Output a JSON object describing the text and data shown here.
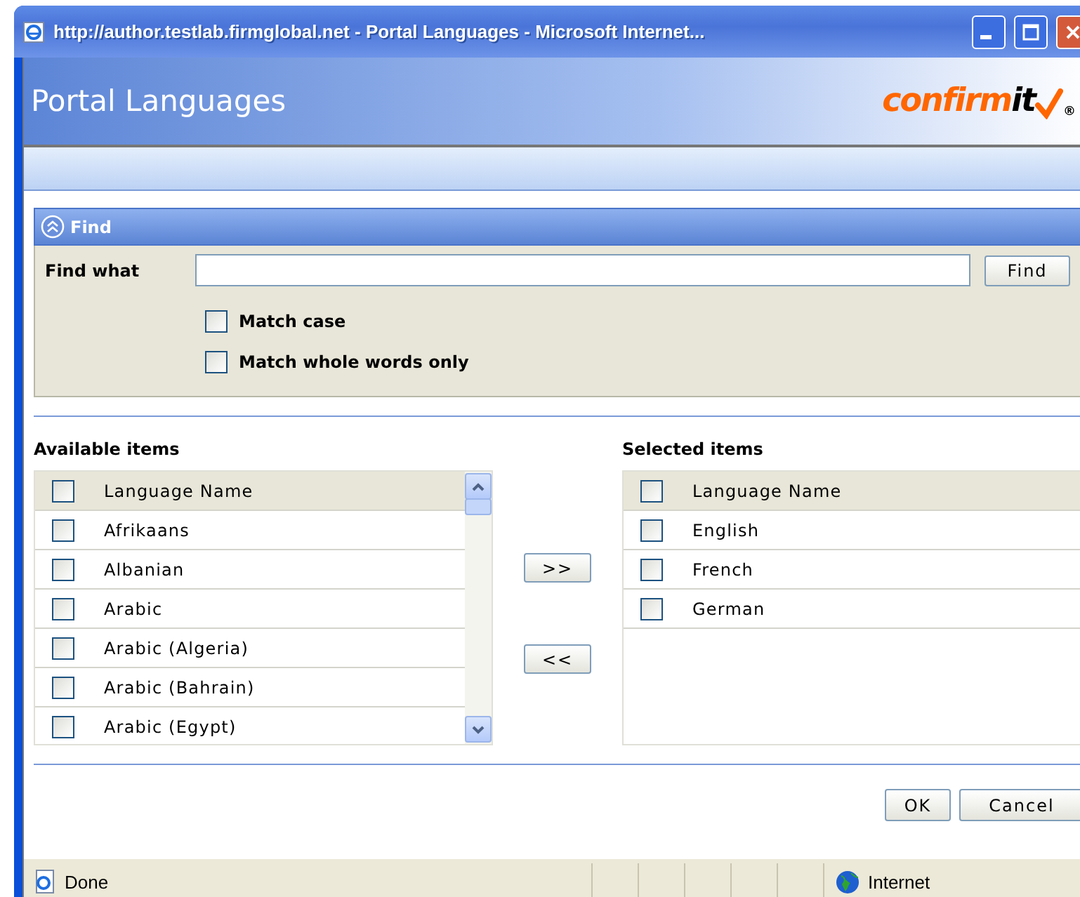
{
  "window": {
    "title": "http://author.testlab.firmglobal.net - Portal Languages - Microsoft Internet..."
  },
  "header": {
    "title": "Portal Languages",
    "logo": {
      "parts": [
        {
          "text": "confirm",
          "color": "#ff6600"
        },
        {
          "text": "it",
          "color": "#000000"
        }
      ],
      "mark": "®"
    }
  },
  "find_panel": {
    "title": "Find",
    "expanded": true,
    "label": "Find what",
    "button": "Find",
    "options": [
      {
        "label": "Match case",
        "checked": false
      },
      {
        "label": "Match whole words only",
        "checked": false
      }
    ]
  },
  "available": {
    "title": "Available items",
    "header": {
      "label": "Language Name",
      "checked": false
    },
    "rows": [
      {
        "name": "Afrikaans",
        "checked": false
      },
      {
        "name": "Albanian",
        "checked": false
      },
      {
        "name": "Arabic",
        "checked": false
      },
      {
        "name": "Arabic (Algeria)",
        "checked": false
      },
      {
        "name": "Arabic (Bahrain)",
        "checked": false
      },
      {
        "name": "Arabic (Egypt)",
        "checked": false
      }
    ]
  },
  "move_buttons": [
    ">>",
    "<<"
  ],
  "selected": {
    "title": "Selected items",
    "header": {
      "label": "Language Name",
      "checked": false
    },
    "rows": [
      {
        "name": "English",
        "checked": false
      },
      {
        "name": "French",
        "checked": false
      },
      {
        "name": "German",
        "checked": false
      }
    ]
  },
  "buttons": [
    "OK",
    "Cancel"
  ],
  "status_bar": {
    "text": "Done",
    "zone": "Internet"
  }
}
